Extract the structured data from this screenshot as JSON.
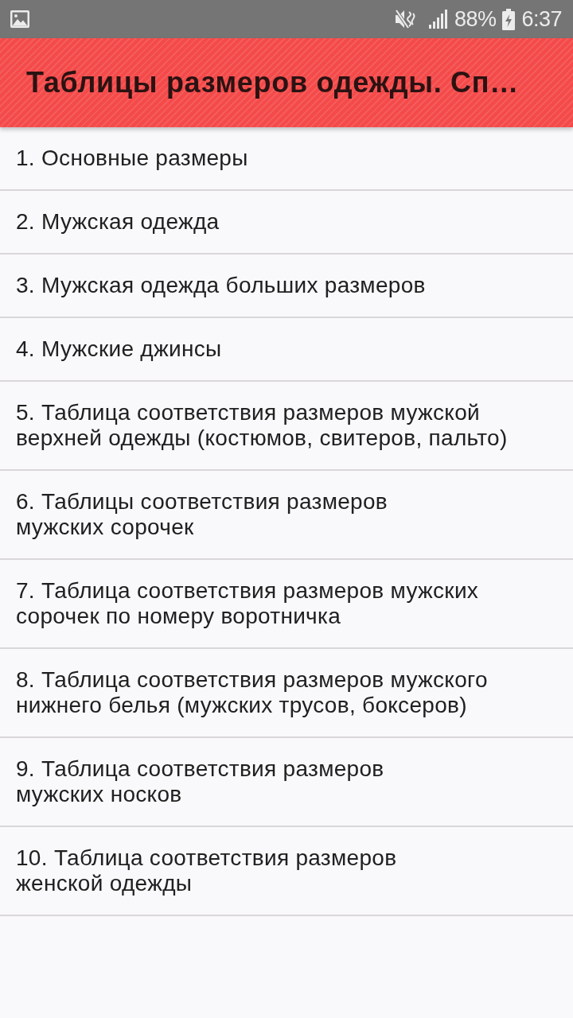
{
  "status_bar": {
    "battery": "88%",
    "time": "6:37"
  },
  "app_bar": {
    "title": "Таблицы размеров одежды. Сп…"
  },
  "list": {
    "items": [
      {
        "text": "1. Основные размеры"
      },
      {
        "text": "2. Мужская одежда"
      },
      {
        "text": "3. Мужская одежда больших размеров"
      },
      {
        "text": "4. Мужские джинсы"
      },
      {
        "text": "5. Таблица соответствия размеров мужской\nверхней одежды (костюмов, свитеров, пальто)"
      },
      {
        "text": "6. Таблицы соответствия размеров\nмужских сорочек"
      },
      {
        "text": "7. Таблица соответствия размеров мужских\nсорочек по номеру воротничка"
      },
      {
        "text": "8. Таблица соответствия размеров мужского\nнижнего белья (мужских трусов, боксеров)"
      },
      {
        "text": "9. Таблица соответствия размеров\nмужских носков"
      },
      {
        "text": "10. Таблица соответствия размеров\nженской одежды"
      }
    ]
  }
}
